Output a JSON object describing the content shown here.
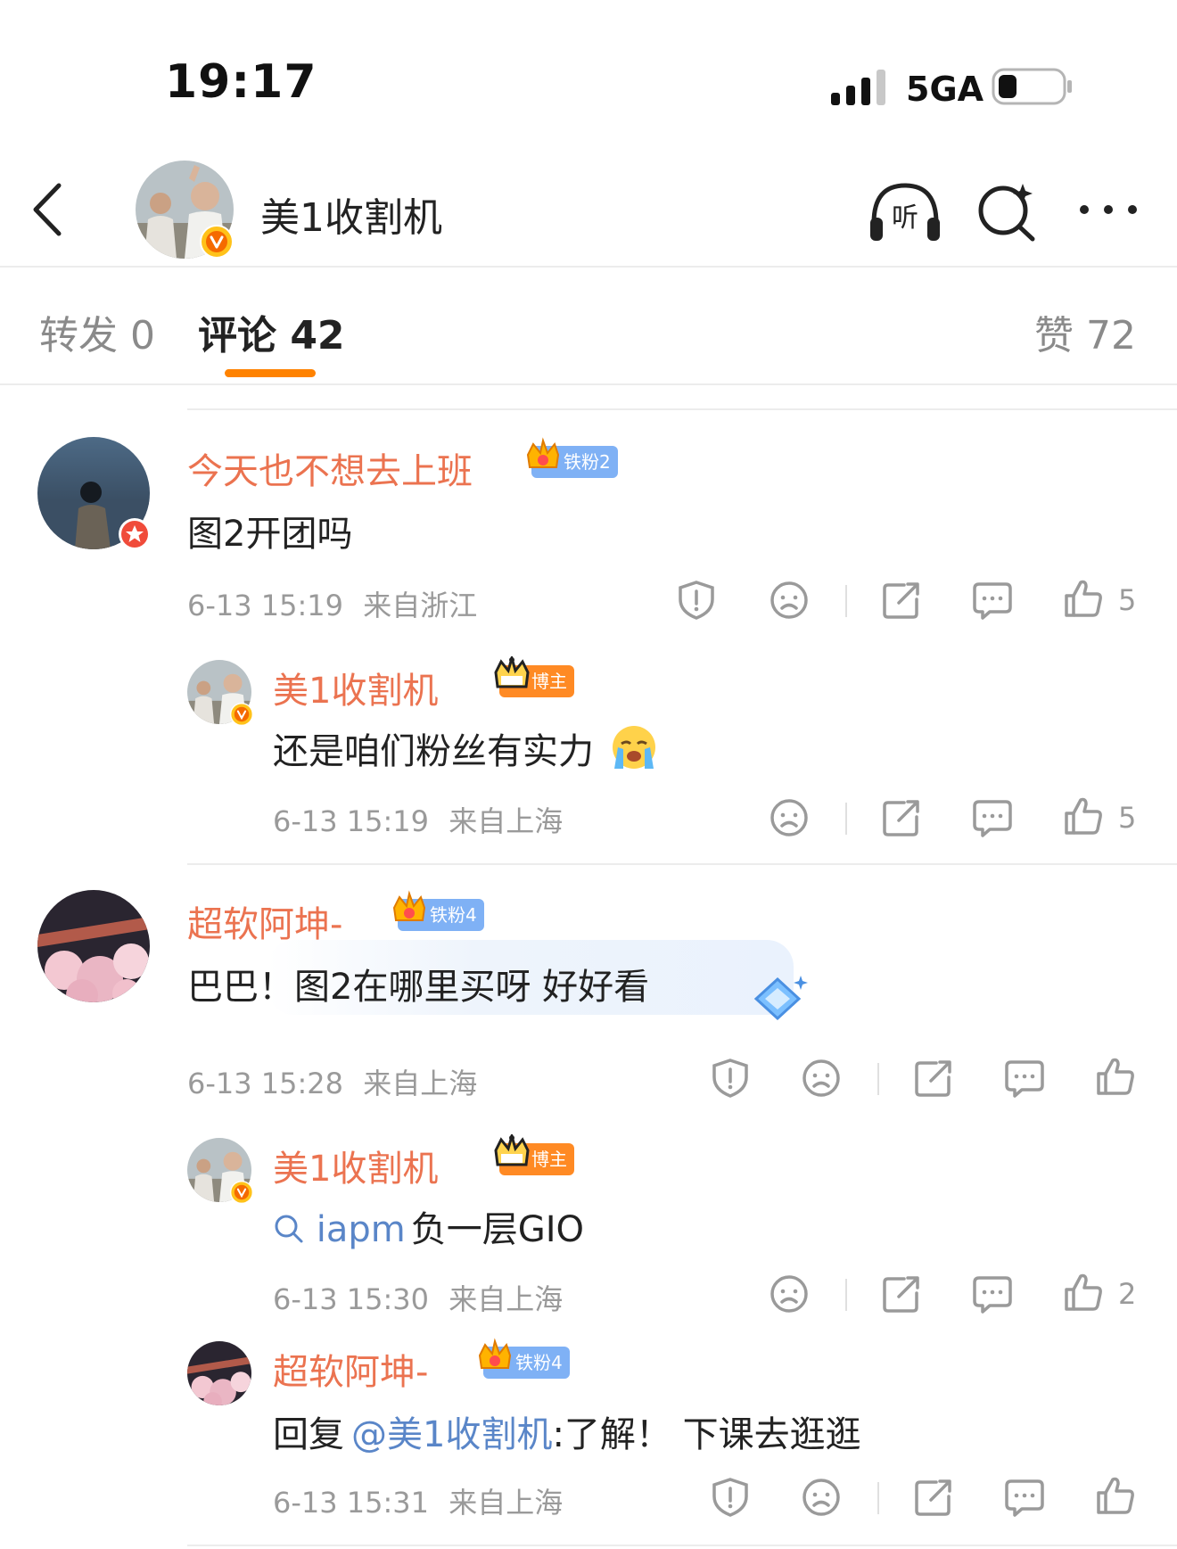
{
  "status_bar": {
    "time": "19:17",
    "network": "5GA"
  },
  "header": {
    "name": "美1收割机",
    "listen_label": "听"
  },
  "tabs": {
    "repost": "转发 0",
    "comments": "评论 42",
    "likes": "赞 72"
  },
  "comments": [
    {
      "user": "今天也不想去上班",
      "badge": "铁粉2",
      "text": "图2开团吗",
      "time": "6-13 15:19",
      "location": "来自浙江",
      "likes": "5"
    },
    {
      "user": "美1收割机",
      "badge": "博主",
      "text": "还是咱们粉丝有实力",
      "time": "6-13 15:19",
      "location": "来自上海",
      "likes": "5"
    },
    {
      "user": "超软阿坤-",
      "badge": "铁粉4",
      "text": "巴巴！图2在哪里买呀 好好看",
      "time": "6-13 15:28",
      "location": "来自上海",
      "likes": ""
    },
    {
      "user": "美1收割机",
      "badge": "博主",
      "text_link": "iapm",
      "text_rest": "负一层GIO",
      "time": "6-13 15:30",
      "location": "来自上海",
      "likes": "2"
    },
    {
      "user": "超软阿坤-",
      "badge": "铁粉4",
      "reply_prefix": "回复",
      "mention": "@美1收割机",
      "text_rest": ":了解！ 下课去逛逛",
      "time": "6-13 15:31",
      "location": "来自上海",
      "likes": ""
    }
  ],
  "colors": {
    "accent": "#ff8200",
    "username": "#eb7350",
    "link": "#5a86c8",
    "meta": "#9a9a9a",
    "fan_badge": "#7fb1f5",
    "host_badge": "#ff8a24"
  }
}
